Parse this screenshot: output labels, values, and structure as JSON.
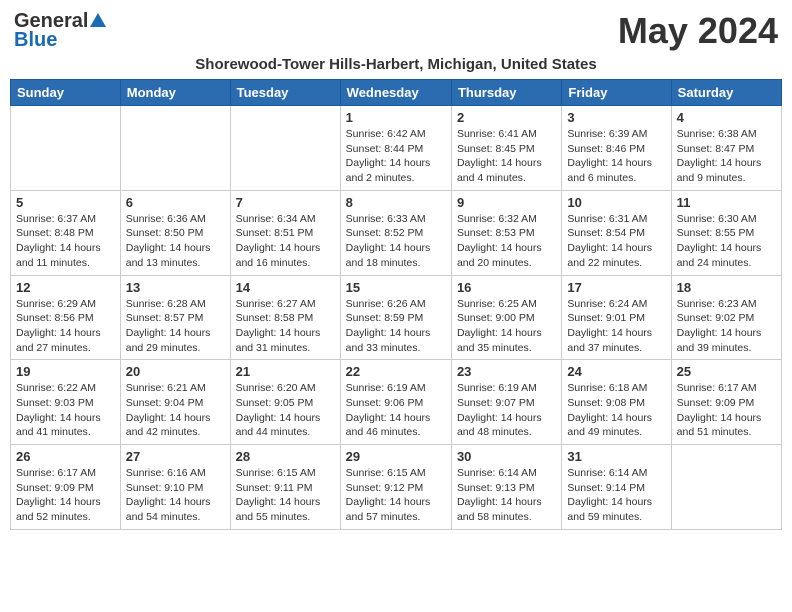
{
  "logo": {
    "general": "General",
    "blue": "Blue"
  },
  "title": "May 2024",
  "subtitle": "Shorewood-Tower Hills-Harbert, Michigan, United States",
  "days_of_week": [
    "Sunday",
    "Monday",
    "Tuesday",
    "Wednesday",
    "Thursday",
    "Friday",
    "Saturday"
  ],
  "weeks": [
    [
      {
        "day": "",
        "info": ""
      },
      {
        "day": "",
        "info": ""
      },
      {
        "day": "",
        "info": ""
      },
      {
        "day": "1",
        "info": "Sunrise: 6:42 AM\nSunset: 8:44 PM\nDaylight: 14 hours\nand 2 minutes."
      },
      {
        "day": "2",
        "info": "Sunrise: 6:41 AM\nSunset: 8:45 PM\nDaylight: 14 hours\nand 4 minutes."
      },
      {
        "day": "3",
        "info": "Sunrise: 6:39 AM\nSunset: 8:46 PM\nDaylight: 14 hours\nand 6 minutes."
      },
      {
        "day": "4",
        "info": "Sunrise: 6:38 AM\nSunset: 8:47 PM\nDaylight: 14 hours\nand 9 minutes."
      }
    ],
    [
      {
        "day": "5",
        "info": "Sunrise: 6:37 AM\nSunset: 8:48 PM\nDaylight: 14 hours\nand 11 minutes."
      },
      {
        "day": "6",
        "info": "Sunrise: 6:36 AM\nSunset: 8:50 PM\nDaylight: 14 hours\nand 13 minutes."
      },
      {
        "day": "7",
        "info": "Sunrise: 6:34 AM\nSunset: 8:51 PM\nDaylight: 14 hours\nand 16 minutes."
      },
      {
        "day": "8",
        "info": "Sunrise: 6:33 AM\nSunset: 8:52 PM\nDaylight: 14 hours\nand 18 minutes."
      },
      {
        "day": "9",
        "info": "Sunrise: 6:32 AM\nSunset: 8:53 PM\nDaylight: 14 hours\nand 20 minutes."
      },
      {
        "day": "10",
        "info": "Sunrise: 6:31 AM\nSunset: 8:54 PM\nDaylight: 14 hours\nand 22 minutes."
      },
      {
        "day": "11",
        "info": "Sunrise: 6:30 AM\nSunset: 8:55 PM\nDaylight: 14 hours\nand 24 minutes."
      }
    ],
    [
      {
        "day": "12",
        "info": "Sunrise: 6:29 AM\nSunset: 8:56 PM\nDaylight: 14 hours\nand 27 minutes."
      },
      {
        "day": "13",
        "info": "Sunrise: 6:28 AM\nSunset: 8:57 PM\nDaylight: 14 hours\nand 29 minutes."
      },
      {
        "day": "14",
        "info": "Sunrise: 6:27 AM\nSunset: 8:58 PM\nDaylight: 14 hours\nand 31 minutes."
      },
      {
        "day": "15",
        "info": "Sunrise: 6:26 AM\nSunset: 8:59 PM\nDaylight: 14 hours\nand 33 minutes."
      },
      {
        "day": "16",
        "info": "Sunrise: 6:25 AM\nSunset: 9:00 PM\nDaylight: 14 hours\nand 35 minutes."
      },
      {
        "day": "17",
        "info": "Sunrise: 6:24 AM\nSunset: 9:01 PM\nDaylight: 14 hours\nand 37 minutes."
      },
      {
        "day": "18",
        "info": "Sunrise: 6:23 AM\nSunset: 9:02 PM\nDaylight: 14 hours\nand 39 minutes."
      }
    ],
    [
      {
        "day": "19",
        "info": "Sunrise: 6:22 AM\nSunset: 9:03 PM\nDaylight: 14 hours\nand 41 minutes."
      },
      {
        "day": "20",
        "info": "Sunrise: 6:21 AM\nSunset: 9:04 PM\nDaylight: 14 hours\nand 42 minutes."
      },
      {
        "day": "21",
        "info": "Sunrise: 6:20 AM\nSunset: 9:05 PM\nDaylight: 14 hours\nand 44 minutes."
      },
      {
        "day": "22",
        "info": "Sunrise: 6:19 AM\nSunset: 9:06 PM\nDaylight: 14 hours\nand 46 minutes."
      },
      {
        "day": "23",
        "info": "Sunrise: 6:19 AM\nSunset: 9:07 PM\nDaylight: 14 hours\nand 48 minutes."
      },
      {
        "day": "24",
        "info": "Sunrise: 6:18 AM\nSunset: 9:08 PM\nDaylight: 14 hours\nand 49 minutes."
      },
      {
        "day": "25",
        "info": "Sunrise: 6:17 AM\nSunset: 9:09 PM\nDaylight: 14 hours\nand 51 minutes."
      }
    ],
    [
      {
        "day": "26",
        "info": "Sunrise: 6:17 AM\nSunset: 9:09 PM\nDaylight: 14 hours\nand 52 minutes."
      },
      {
        "day": "27",
        "info": "Sunrise: 6:16 AM\nSunset: 9:10 PM\nDaylight: 14 hours\nand 54 minutes."
      },
      {
        "day": "28",
        "info": "Sunrise: 6:15 AM\nSunset: 9:11 PM\nDaylight: 14 hours\nand 55 minutes."
      },
      {
        "day": "29",
        "info": "Sunrise: 6:15 AM\nSunset: 9:12 PM\nDaylight: 14 hours\nand 57 minutes."
      },
      {
        "day": "30",
        "info": "Sunrise: 6:14 AM\nSunset: 9:13 PM\nDaylight: 14 hours\nand 58 minutes."
      },
      {
        "day": "31",
        "info": "Sunrise: 6:14 AM\nSunset: 9:14 PM\nDaylight: 14 hours\nand 59 minutes."
      },
      {
        "day": "",
        "info": ""
      }
    ]
  ]
}
